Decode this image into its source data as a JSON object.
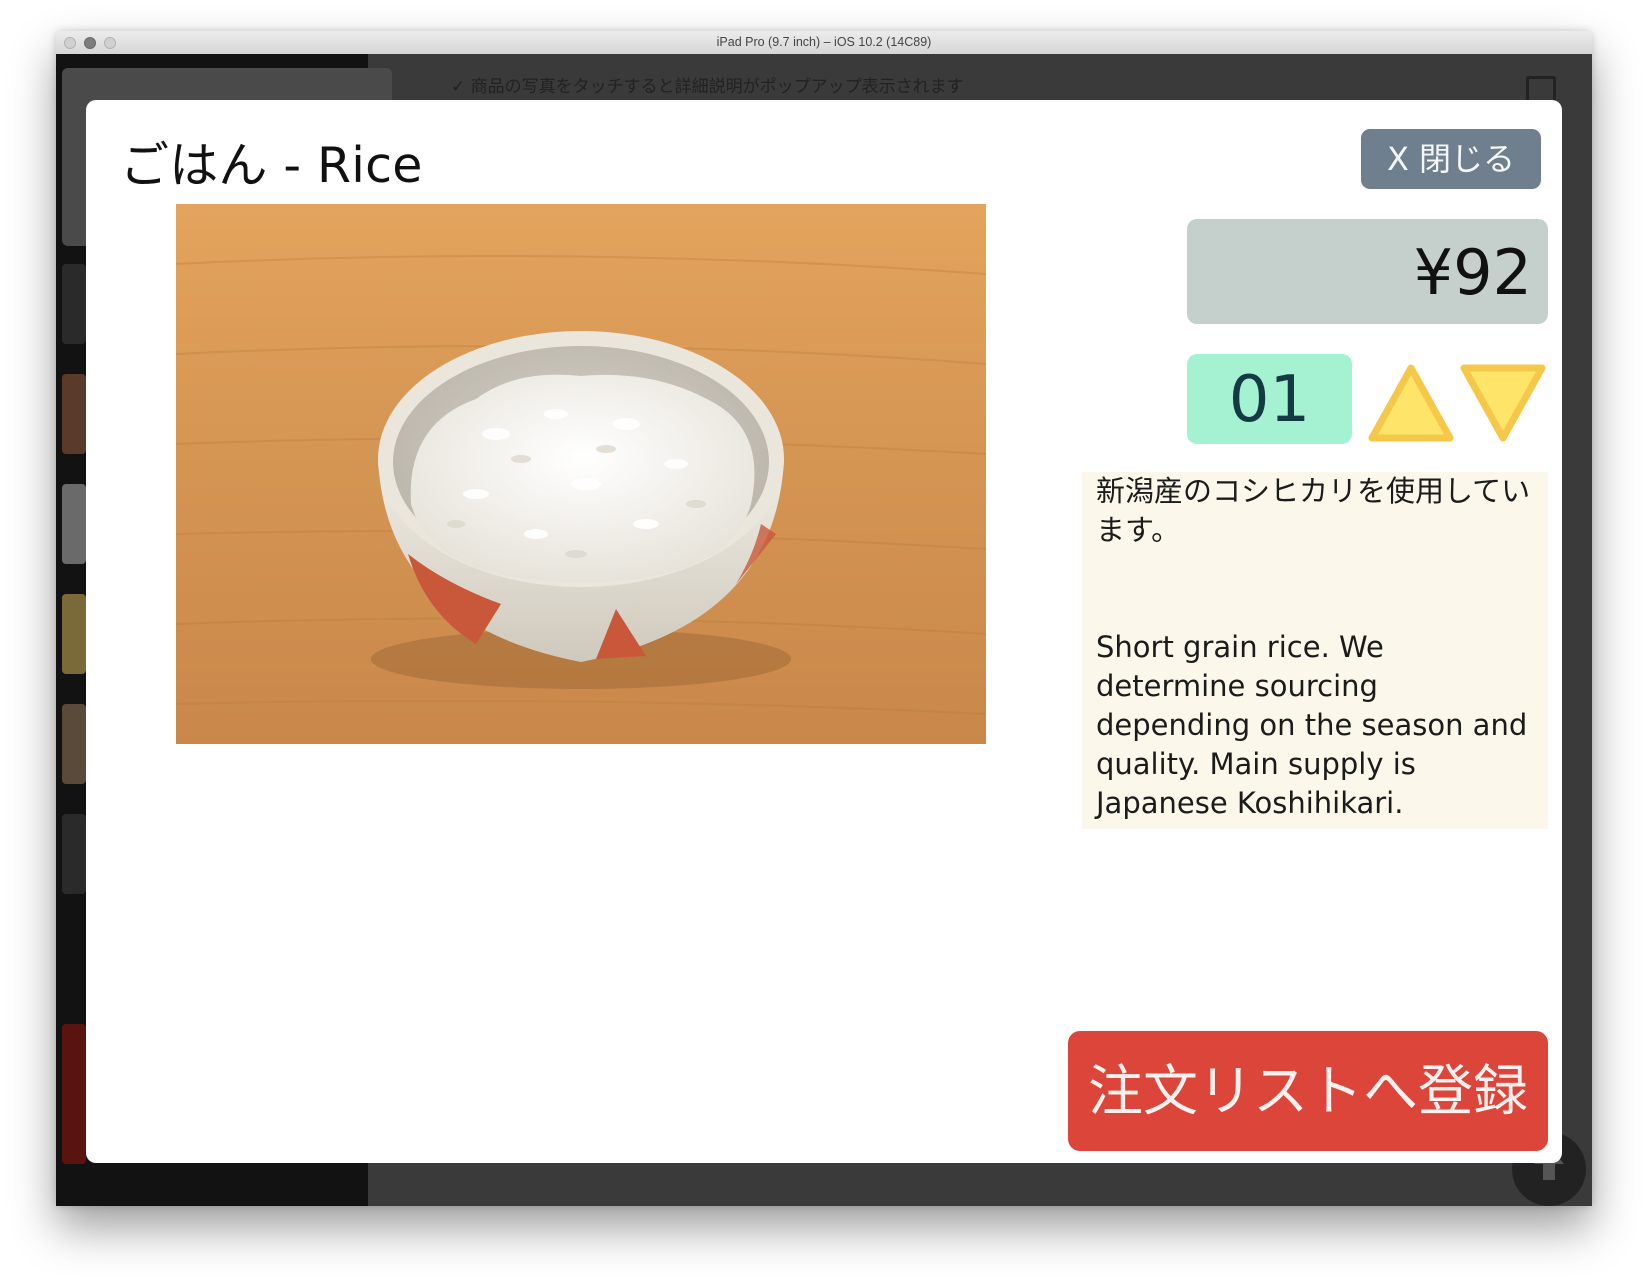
{
  "window": {
    "title": "iPad Pro (9.7 inch) – iOS 10.2 (14C89)"
  },
  "background_app": {
    "hint_text": "✓ 商品の写真をタッチすると詳細説明がポップアップ表示されます"
  },
  "modal": {
    "title": "ごはん - Rice",
    "close_label": "X 閉じる",
    "price": "¥92",
    "quantity": "01",
    "description_jp": "新潟産のコシヒカリを使用しています。",
    "description_en": "Short grain rice. We determine sourcing depending on the season and quality. Main supply is  Japanese Koshihikari.",
    "order_button_label": "注文リストへ登録"
  },
  "icons": {
    "increment": "triangle-up-icon",
    "decrement": "triangle-down-icon",
    "scroll_top": "arrow-up-icon",
    "clipboard": "clipboard-icon"
  },
  "colors": {
    "close_button": "#6f7f8d",
    "price_box": "#c5d0cc",
    "quantity_box": "#a4f2d2",
    "stepper_arrows": "#ffe46a",
    "description_bg": "#fbf7ea",
    "order_button": "#dc4539"
  }
}
